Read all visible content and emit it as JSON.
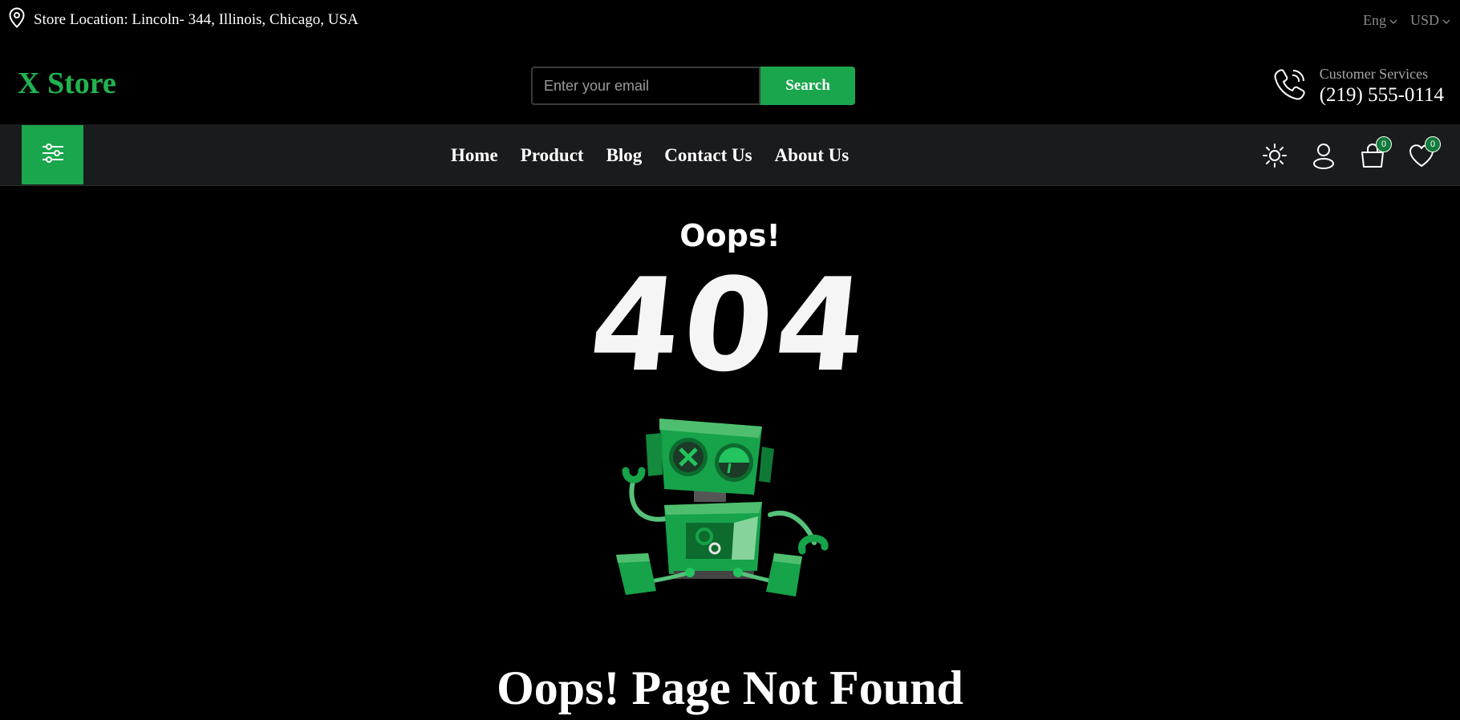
{
  "topbar": {
    "location": "Store Location: Lincoln- 344, Illinois, Chicago, USA",
    "language": "Eng",
    "currency": "USD"
  },
  "header": {
    "logo": "X Store",
    "search_placeholder": "Enter your email",
    "search_button": "Search",
    "service_label": "Customer Services",
    "service_phone": "(219) 555-0114"
  },
  "nav": {
    "links": [
      "Home",
      "Product",
      "Blog",
      "Contact Us",
      "About Us"
    ],
    "cart_count": "0",
    "wishlist_count": "0"
  },
  "error": {
    "oops": "Oops!",
    "code": "404",
    "heading": "Oops! Page Not Found"
  },
  "colors": {
    "accent": "#1aa64d",
    "logo": "#22b351",
    "background": "#000000",
    "navbar": "#1a1b1d"
  }
}
